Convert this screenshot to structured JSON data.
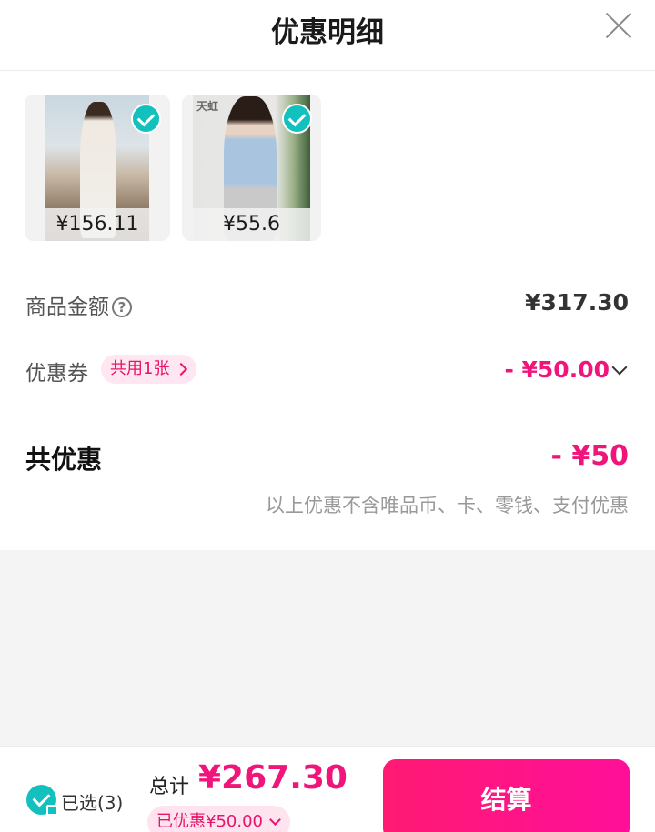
{
  "header": {
    "title": "优惠明细"
  },
  "products": [
    {
      "price": "¥156.11",
      "selected": true
    },
    {
      "price": "¥55.6",
      "selected": true,
      "brand": "天虹"
    }
  ],
  "summary": {
    "goods_label": "商品金额",
    "goods_value": "¥317.30",
    "coupon_label": "优惠券",
    "coupon_badge": "共用1张",
    "coupon_value": "- ¥50.00",
    "total_label": "共优惠",
    "total_value": "- ¥50",
    "note": "以上优惠不含唯品币、卡、零钱、支付优惠"
  },
  "footer": {
    "selected": "已选(3)",
    "sum_label": "总计",
    "sum_value": "¥267.30",
    "saved": "已优惠¥50.00",
    "checkout": "结算"
  },
  "colors": {
    "accent": "#f0157a",
    "teal": "#12c0be"
  }
}
